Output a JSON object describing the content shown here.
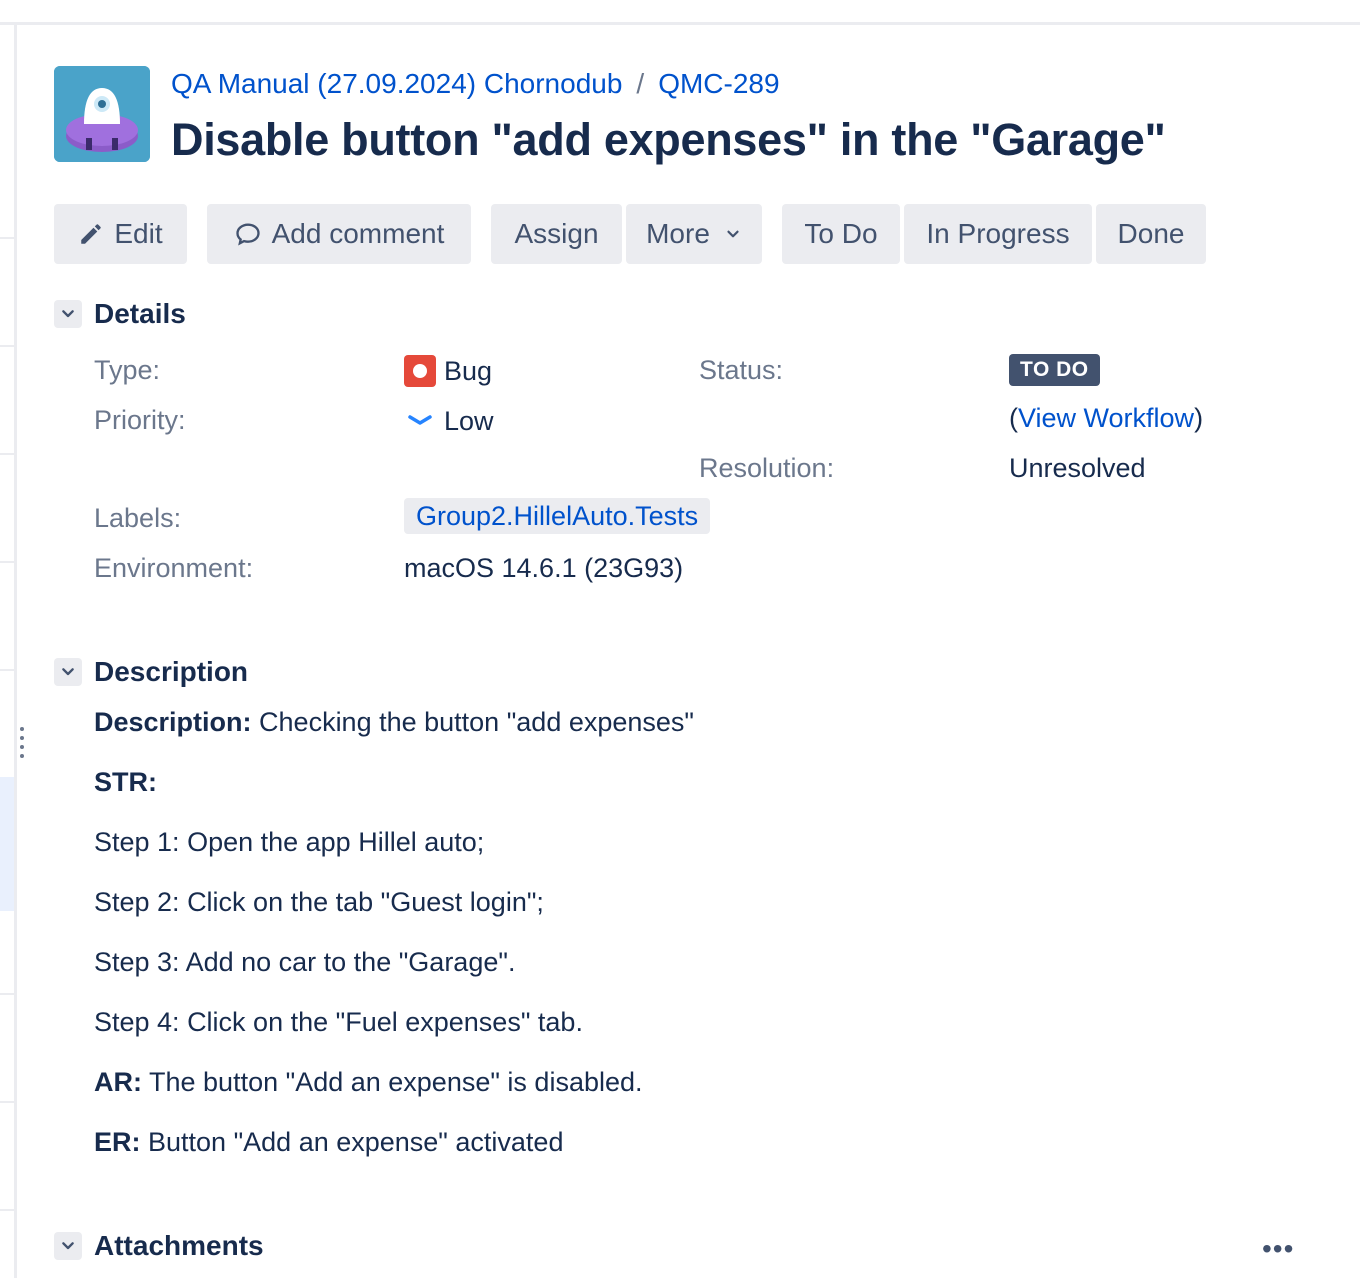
{
  "breadcrumb": {
    "project": "QA Manual (27.09.2024) Chornodub",
    "separator": "/",
    "issue_key": "QMC-289"
  },
  "issue": {
    "title": "Disable button \"add expenses\" in the \"Garage\""
  },
  "toolbar": {
    "edit": "Edit",
    "add_comment": "Add comment",
    "assign": "Assign",
    "more": "More",
    "to_do": "To Do",
    "in_progress": "In Progress",
    "done": "Done"
  },
  "details": {
    "heading": "Details",
    "type_label": "Type:",
    "type_value": "Bug",
    "priority_label": "Priority:",
    "priority_value": "Low",
    "labels_label": "Labels:",
    "labels_value": "Group2.HillelAuto.Tests",
    "environment_label": "Environment:",
    "environment_value": "macOS 14.6.1 (23G93)",
    "status_label": "Status:",
    "status_value": "TO DO",
    "view_workflow_open": "(",
    "view_workflow": "View Workflow",
    "view_workflow_close": ")",
    "resolution_label": "Resolution:",
    "resolution_value": "Unresolved"
  },
  "description": {
    "heading": "Description",
    "desc_label": "Description:",
    "desc_text": " Checking the button \"add expenses\"",
    "str_label": "STR:",
    "step1": "Step 1: Open the app Hillel auto;",
    "step2": "Step 2: Click on the tab \"Guest login\";",
    "step3": "Step 3: Add no car to the \"Garage\".",
    "step4": "Step 4: Click on the \"Fuel expenses\" tab.",
    "ar_label": "AR:",
    "ar_text": " The button \"Add an expense\" is disabled.",
    "er_label": "ER:",
    "er_text": " Button \"Add an expense\" activated"
  },
  "attachments": {
    "heading": "Attachments",
    "menu": "•••"
  },
  "colors": {
    "link": "#0052cc",
    "text": "#172b4d",
    "muted": "#6b778c",
    "button_bg": "#ebecf0",
    "lozenge_bg": "#42526e",
    "bug": "#e5493a",
    "priority_low": "#2684ff",
    "avatar_bg": "#4aa3c9"
  }
}
